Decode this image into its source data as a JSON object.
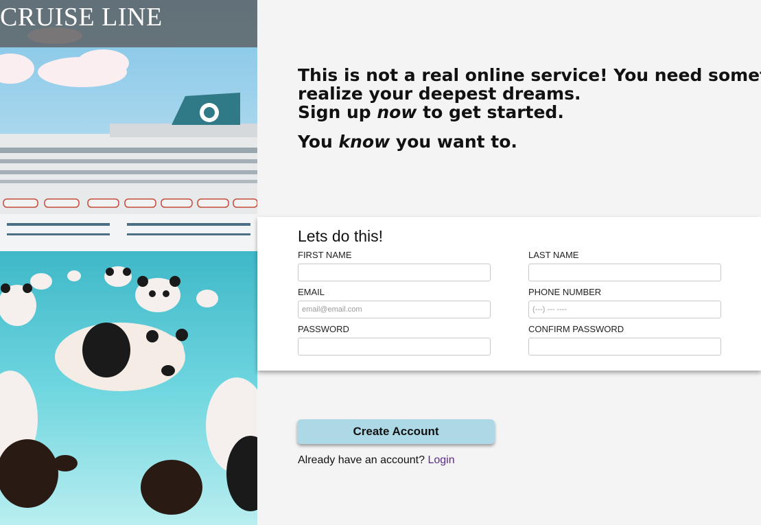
{
  "brand": {
    "name": "CRUISE LINE"
  },
  "intro": {
    "line1": "This is not a real online service! You need something like this to",
    "line2": "realize your deepest dreams.",
    "line3_pre": "Sign up ",
    "line3_em": "now",
    "line3_post": " to get started.",
    "line4_pre": "You ",
    "line4_em": "know",
    "line4_post": " you want to."
  },
  "form": {
    "title": "Lets do this!",
    "first_name": {
      "label": "FIRST NAME",
      "value": "",
      "placeholder": ""
    },
    "last_name": {
      "label": "LAST NAME",
      "value": "",
      "placeholder": ""
    },
    "email": {
      "label": "EMAIL",
      "value": "",
      "placeholder": "email@email.com"
    },
    "phone": {
      "label": "PHONE NUMBER",
      "value": "",
      "placeholder": "(---) --- ----"
    },
    "password": {
      "label": "PASSWORD",
      "value": "",
      "placeholder": ""
    },
    "confirm_password": {
      "label": "CONFIRM PASSWORD",
      "value": "",
      "placeholder": ""
    }
  },
  "actions": {
    "create_label": "Create Account",
    "login_prompt": "Already have an account?",
    "login_label": "Login"
  },
  "colors": {
    "button_bg": "#add8e6",
    "link": "#5b2a86",
    "page_bg": "#f4f4f4",
    "water": "#4ec7d2"
  },
  "hero_image": {
    "icon": "cruise-ship-with-pandas-image"
  }
}
